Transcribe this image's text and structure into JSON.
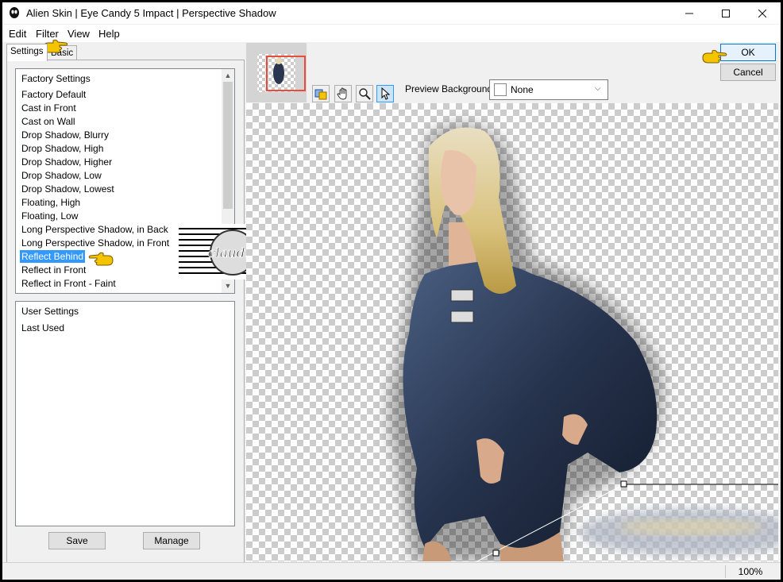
{
  "window": {
    "title": "Alien Skin | Eye Candy 5 Impact | Perspective Shadow",
    "controls": [
      "minimize",
      "maximize",
      "close"
    ]
  },
  "menu": [
    "Edit",
    "Filter",
    "View",
    "Help"
  ],
  "tabs": [
    {
      "label": "Settings",
      "active": true
    },
    {
      "label": "Basic",
      "active": false
    }
  ],
  "factory_settings": {
    "header": "Factory Settings",
    "items": [
      "Factory Default",
      "Cast in Front",
      "Cast on Wall",
      "Drop Shadow, Blurry",
      "Drop Shadow, High",
      "Drop Shadow, Higher",
      "Drop Shadow, Low",
      "Drop Shadow, Lowest",
      "Floating, High",
      "Floating, Low",
      "Long Perspective Shadow, in Back",
      "Long Perspective Shadow, in Front",
      "Reflect Behind",
      "Reflect in Front",
      "Reflect in Front - Faint"
    ],
    "selected": "Reflect Behind"
  },
  "user_settings": {
    "header": "User Settings",
    "items": [
      "Last Used"
    ]
  },
  "buttons": {
    "save": "Save",
    "manage": "Manage",
    "ok": "OK",
    "cancel": "Cancel"
  },
  "preview_background": {
    "label": "Preview Background:",
    "value": "None"
  },
  "toolbar_icons": [
    "preview-toggle-icon",
    "hand-icon",
    "zoom-icon",
    "arrow-select-icon"
  ],
  "watermark": {
    "text": "claudia"
  },
  "status": {
    "zoom": "100%"
  },
  "colors": {
    "selection": "#3399ff",
    "pointer_hand": "#f5c400",
    "thumbnail_frame": "#e74c3c"
  }
}
